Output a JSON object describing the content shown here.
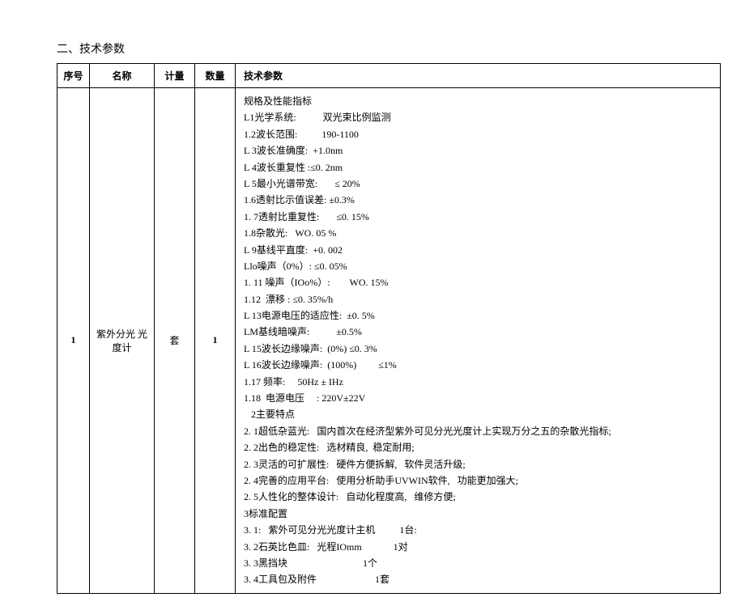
{
  "section_title": "二、技术参数",
  "headers": {
    "index": "序号",
    "name": "名称",
    "unit": "计量",
    "qty": "数量",
    "spec": "技术参数"
  },
  "row": {
    "index": "1",
    "name": "紫外分光 光度计",
    "unit": "套",
    "qty": "1",
    "spec_lines": [
      "规格及性能指标",
      "L1光学系统:           双光束比例监测",
      "1.2波长范围:          190-1100",
      "L 3波长准确度:  +1.0nm",
      "L 4波长重复性 :≤0. 2nm",
      "L 5最小光谱带宽:       ≤ 20%",
      "1.6透射比示值误差: ±0.3%",
      "1. 7透射比重复性:       ≤0. 15%",
      "1.8杂散光:   WO. 05 %",
      "L 9基线平直度:  +0. 002",
      "Llo噪声（0%）: ≤0. 05%",
      "1. 11 噪声（IOo%）:        WO. 15%",
      "1.12  漂移 : ≤0. 35%/h",
      "L 13电源电压的适应性:  ±0. 5%",
      "LM基线暗噪声:           ±0.5%",
      "L 15波长边缘噪声:  (0%) ≤0. 3%",
      "L 16波长边缘噪声:  (100%)         ≤1%",
      "1.17 频率:     50Hz ± IHz",
      "1.18  电源电压     : 220V±22V",
      "   2主要特点",
      "2. 1超低杂蓝光:   国内首次在经济型紫外可见分光光度计上实现万分之五的杂散光指标;",
      "2. 2出色的稳定性:   选材精良,  稳定耐用;",
      "2. 3灵活的可扩展性:   硬件方便拆解,   软件灵活升级;",
      "2. 4完善的应用平台:   使用分析助手UVWIN软件,   功能更加强大;",
      "2. 5人性化的整体设计:   自动化程度高,   维修方便;",
      "3标准配置",
      "3. 1:   紫外可见分光光度计主机          1台:",
      "3. 2石英比色皿:   光程IOmm             1对",
      "3. 3黑挡块                               1个",
      "3. 4工具包及附件                        1套"
    ]
  }
}
